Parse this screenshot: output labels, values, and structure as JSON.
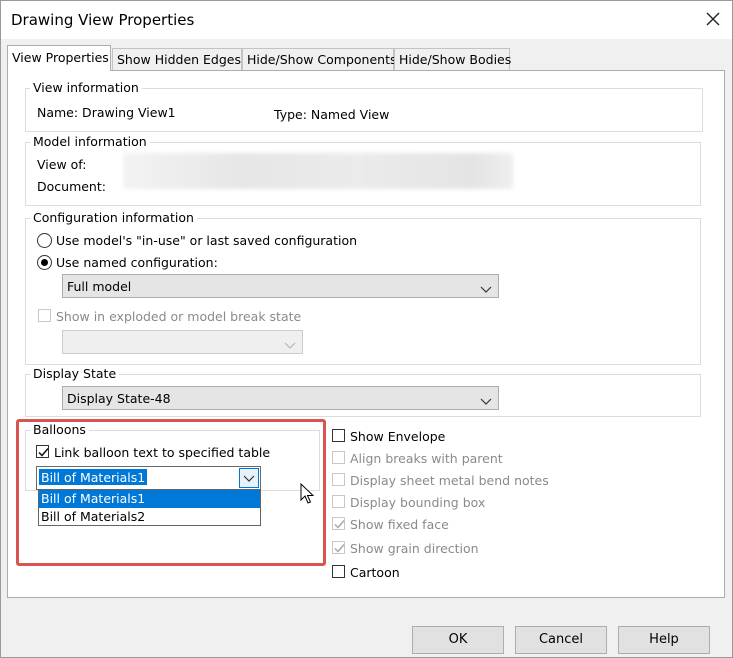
{
  "window": {
    "title": "Drawing View Properties"
  },
  "tabs": [
    {
      "label": "View Properties",
      "active": true
    },
    {
      "label": "Show Hidden Edges",
      "active": false
    },
    {
      "label": "Hide/Show Components",
      "active": false
    },
    {
      "label": "Hide/Show Bodies",
      "active": false
    }
  ],
  "view_information": {
    "title": "View information",
    "name_label": "Name: Drawing View1",
    "type_label": "Type: Named View"
  },
  "model_information": {
    "title": "Model information",
    "view_of_label": "View of:",
    "document_label": "Document:"
  },
  "configuration_information": {
    "title": "Configuration information",
    "option_in_use": "Use model's \"in-use\" or last saved configuration",
    "option_named": "Use named configuration:",
    "named_config_value": "Full model",
    "show_exploded_label": "Show in exploded or model break state",
    "exploded_combo_value": ""
  },
  "display_state": {
    "title": "Display State",
    "value": "Display State-48"
  },
  "balloons": {
    "title": "Balloons",
    "link_label": "Link balloon text to specified table",
    "link_checked": true,
    "table_value": "Bill of Materials1",
    "dropdown_options": [
      "Bill of Materials1",
      "Bill of Materials2"
    ],
    "dropdown_selected": "Bill of Materials1"
  },
  "options": {
    "show_envelope": "Show Envelope",
    "align_breaks": "Align breaks with parent",
    "sheet_metal_notes": "Display sheet metal bend notes",
    "bounding_box": "Display bounding box",
    "fixed_face": "Show fixed face",
    "grain_direction": "Show grain direction",
    "cartoon": "Cartoon"
  },
  "buttons": {
    "ok": "OK",
    "cancel": "Cancel",
    "help": "Help"
  },
  "colors": {
    "accent": "#0078d7",
    "highlight_border": "#d9534f"
  }
}
